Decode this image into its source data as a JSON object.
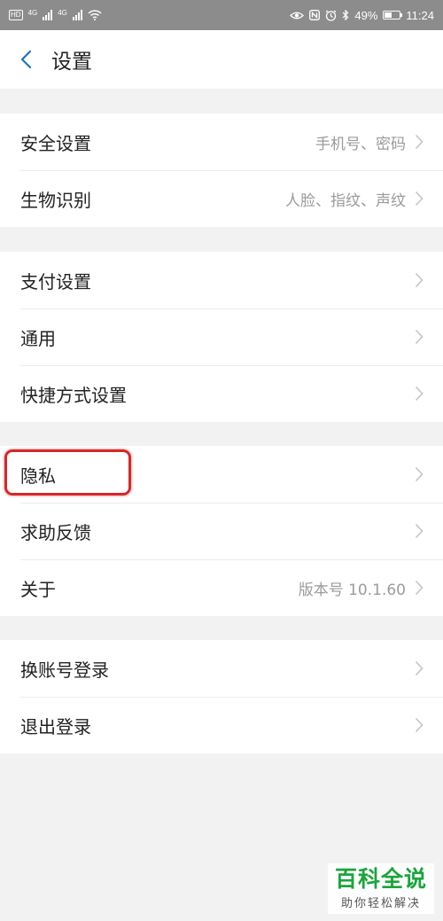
{
  "status_bar": {
    "left_badge": "HD",
    "network1": "4G",
    "network2": "4G",
    "battery_text": "49%",
    "battery_level": 0.49,
    "time": "11:24"
  },
  "header": {
    "title": "设置"
  },
  "groups": [
    {
      "items": [
        {
          "label": "安全设置",
          "value": "手机号、密码"
        },
        {
          "label": "生物识别",
          "value": "人脸、指纹、声纹"
        }
      ]
    },
    {
      "items": [
        {
          "label": "支付设置",
          "value": ""
        },
        {
          "label": "通用",
          "value": ""
        },
        {
          "label": "快捷方式设置",
          "value": ""
        }
      ]
    },
    {
      "items": [
        {
          "label": "隐私",
          "value": ""
        },
        {
          "label": "求助反馈",
          "value": ""
        },
        {
          "label": "关于",
          "value": "版本号 10.1.60"
        }
      ]
    },
    {
      "items": [
        {
          "label": "换账号登录",
          "value": ""
        },
        {
          "label": "退出登录",
          "value": ""
        }
      ]
    }
  ],
  "watermark": {
    "main": "百科全说",
    "sub": "助你轻松解决"
  },
  "colors": {
    "accent": "#1a73c8",
    "highlight": "#d92626",
    "watermark_green": "#1aa53b"
  }
}
